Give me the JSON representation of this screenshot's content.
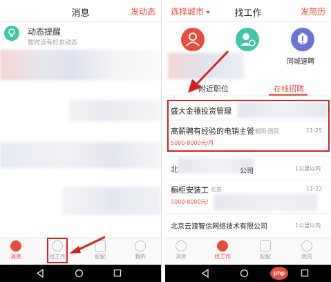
{
  "left": {
    "header": {
      "title": "消息",
      "action": "发动态"
    },
    "notification": {
      "title": "动态提醒",
      "subtitle": "暂时没有好友动态"
    },
    "nav": [
      {
        "label": "消息",
        "active": true
      },
      {
        "label": "找工作",
        "active": false
      },
      {
        "label": "配配",
        "active": false
      },
      {
        "label": "我的",
        "active": false
      }
    ]
  },
  "right": {
    "header": {
      "title": "找工作",
      "left": "选择城市",
      "right": "发简历"
    },
    "icons": [
      {
        "name": "user-icon",
        "color": "#e84c3d",
        "label": ""
      },
      {
        "name": "group-icon",
        "color": "#3ec7a5",
        "label": ""
      },
      {
        "name": "alert-icon",
        "color": "#6b72d8",
        "label": "同城速聘"
      }
    ],
    "tabs": {
      "nearby": "附近职位",
      "online": "在线招聘"
    },
    "jobs": [
      {
        "title": "盛大金禧投资管理",
        "location": "",
        "date": "",
        "salary": ""
      },
      {
        "title": "高薪聘有经验的电销主管",
        "location": "朝阳-国贸",
        "date": "11-25",
        "salary": "5000-8000元/月"
      },
      {
        "title": "北",
        "location": "",
        "date": "1公里以内",
        "salary": "公司"
      },
      {
        "title": "橱柜安装工",
        "location": "北京",
        "date": "11-22",
        "salary": "5000-8000元/"
      },
      {
        "title": "北京云渡智信网络技术有限公司",
        "location": "",
        "date": "1公里以内",
        "salary": ""
      }
    ],
    "nav": [
      {
        "label": "消息",
        "active": false
      },
      {
        "label": "找工作",
        "active": true
      },
      {
        "label": "配配",
        "active": false
      },
      {
        "label": "我的",
        "active": false
      }
    ],
    "watermark": "php"
  },
  "colors": {
    "accent": "#e84c3d",
    "highlight": "#d81e1e",
    "teal": "#3ec7a5",
    "purple": "#6b72d8"
  }
}
